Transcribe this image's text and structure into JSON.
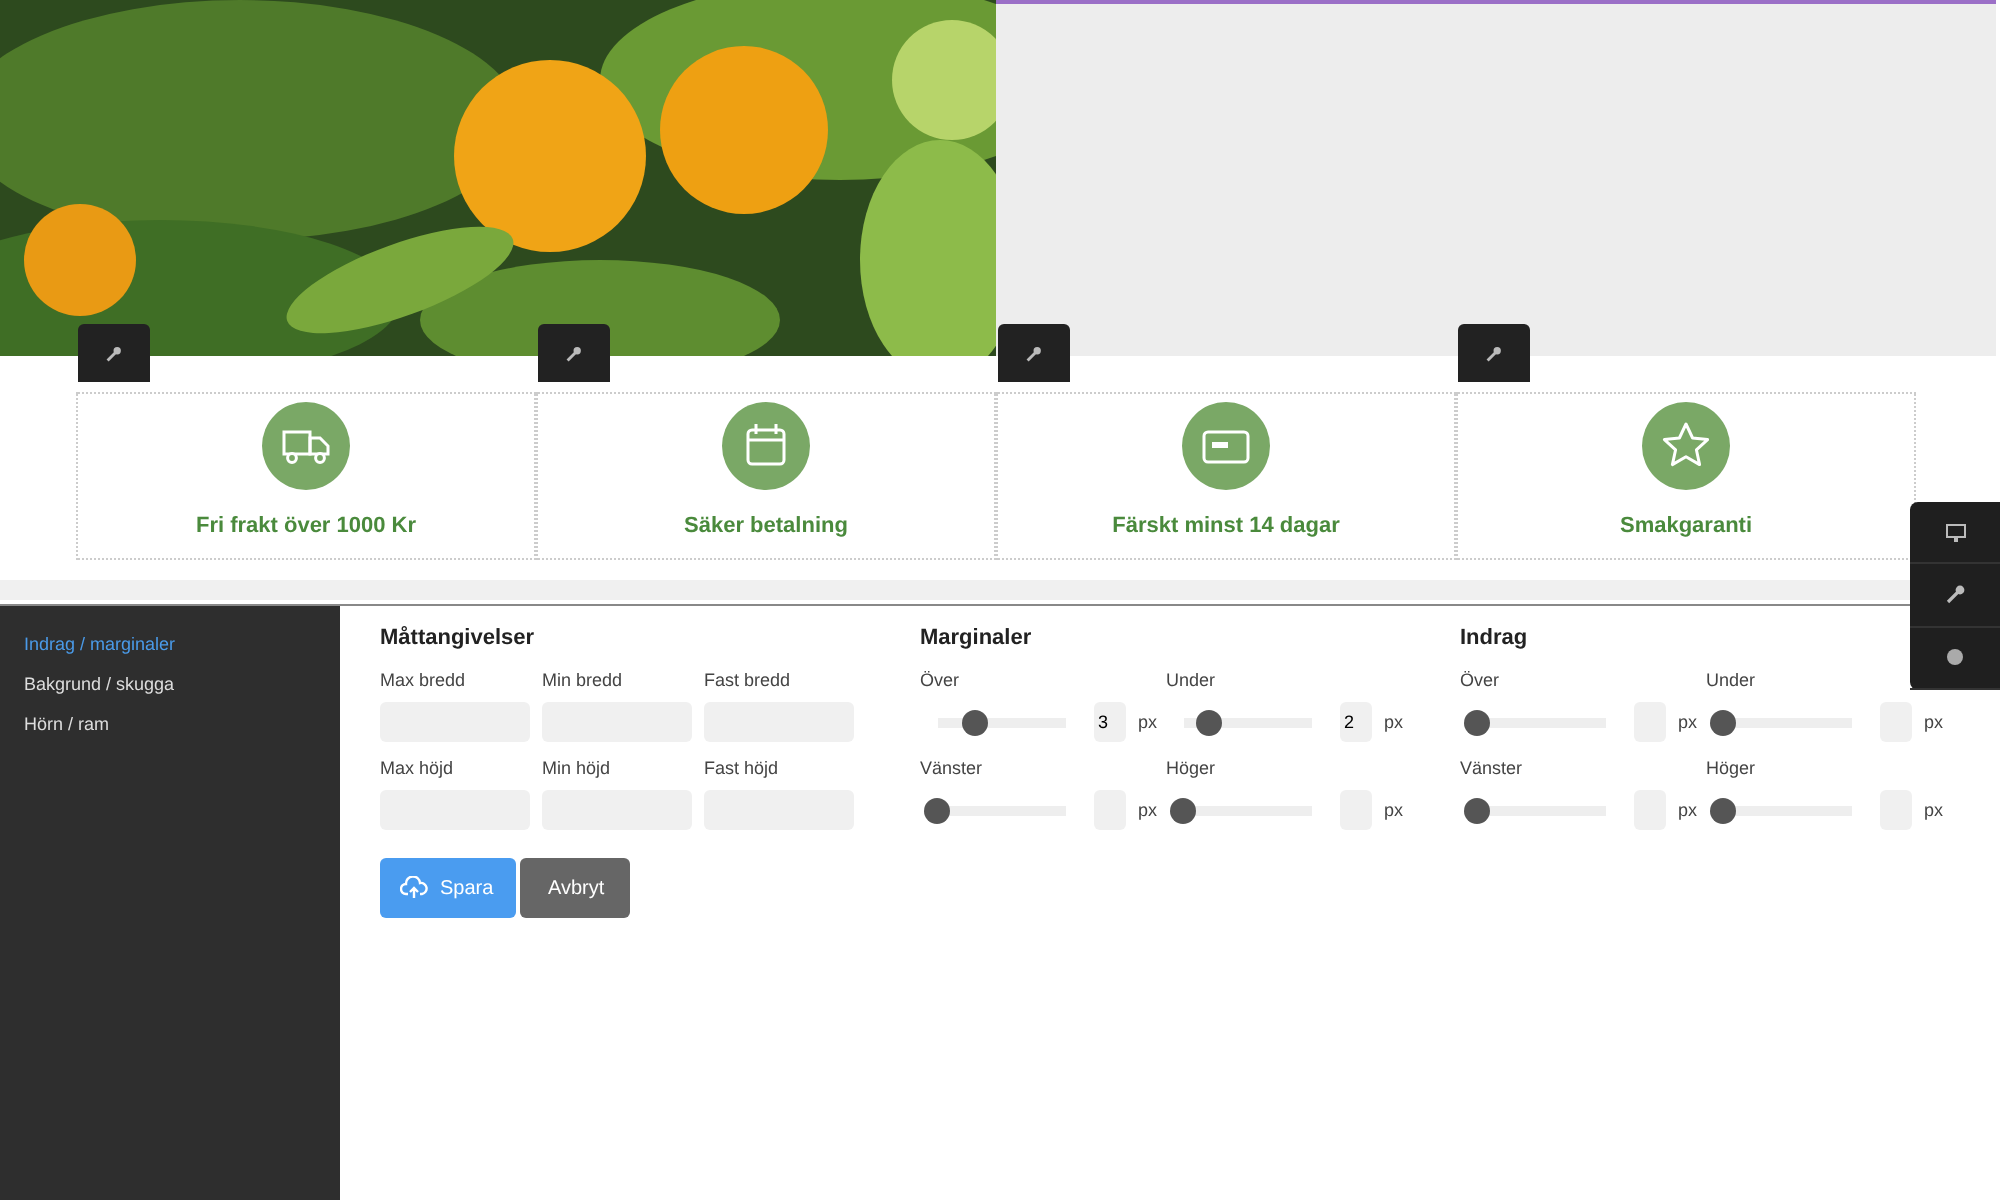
{
  "features": [
    {
      "label": "Fri frakt över 1000 Kr",
      "kind": "truck"
    },
    {
      "label": "Säker betalning",
      "kind": "calendar"
    },
    {
      "label": "Färskt minst 14 dagar",
      "kind": "card"
    },
    {
      "label": "Smakgaranti",
      "kind": "star"
    }
  ],
  "sidebar": {
    "items": [
      {
        "label": "Indrag / marginaler",
        "selected": true
      },
      {
        "label": "Bakgrund / skugga",
        "selected": false
      },
      {
        "label": "Hörn / ram",
        "selected": false
      }
    ]
  },
  "sections": [
    {
      "title": "Måttangivelser",
      "kind": "inputs",
      "fields": [
        {
          "label": "Max bredd"
        },
        {
          "label": "Min bredd"
        },
        {
          "label": "Fast bredd"
        },
        {
          "label": "Max höjd"
        },
        {
          "label": "Min höjd"
        },
        {
          "label": "Fast höjd"
        }
      ]
    },
    {
      "title": "Marginaler",
      "kind": "sliders",
      "fields": [
        {
          "label": "Över",
          "level": 0.3,
          "value": "3",
          "unit": "px"
        },
        {
          "label": "Under",
          "level": 0.2,
          "value": "2",
          "unit": "px"
        },
        {
          "label": "Vänster",
          "level": 0,
          "unit": "px"
        },
        {
          "label": "Höger",
          "level": 0,
          "unit": "px"
        }
      ]
    },
    {
      "title": "Indrag",
      "kind": "sliders",
      "fields": [
        {
          "label": "Över",
          "level": 0,
          "unit": "px"
        },
        {
          "label": "Under",
          "level": 0,
          "unit": "px"
        },
        {
          "label": "Vänster",
          "level": 0,
          "unit": "px"
        },
        {
          "label": "Höger",
          "level": 0,
          "unit": "px"
        }
      ]
    }
  ],
  "buttons": [
    {
      "label": "Spara",
      "kind": "primary"
    },
    {
      "label": "Avbryt",
      "kind": "secondary"
    }
  ]
}
